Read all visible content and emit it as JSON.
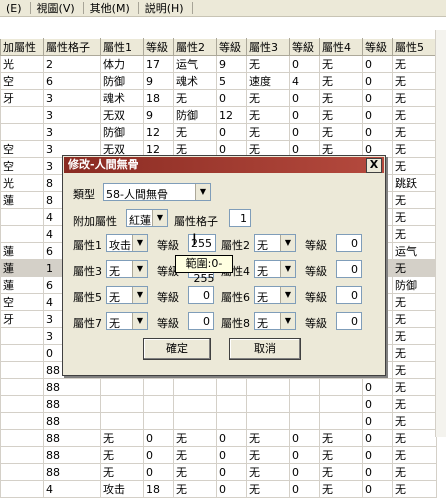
{
  "menu": [
    "(E)",
    "視圖(V)",
    "其他(M)",
    "説明(H)"
  ],
  "grid": {
    "headers": [
      "加屬性",
      "屬性格子",
      "屬性1",
      "等級",
      "屬性2",
      "等級",
      "屬性3",
      "等級",
      "屬性4",
      "等級",
      "屬性5"
    ],
    "rows": [
      [
        "光",
        "2",
        "体力",
        "17",
        "运气",
        "9",
        "无",
        "0",
        "无",
        "0",
        "无"
      ],
      [
        "空",
        "6",
        "防御",
        "9",
        "魂术",
        "5",
        "速度",
        "4",
        "无",
        "0",
        "无"
      ],
      [
        "牙",
        "3",
        "魂术",
        "18",
        "无",
        "0",
        "无",
        "0",
        "无",
        "0",
        "无"
      ],
      [
        "",
        "3",
        "无双",
        "9",
        "防御",
        "12",
        "无",
        "0",
        "无",
        "0",
        "无"
      ],
      [
        "",
        "3",
        "防御",
        "12",
        "无",
        "0",
        "无",
        "0",
        "无",
        "0",
        "无"
      ],
      [
        "空",
        "3",
        "无双",
        "12",
        "无",
        "0",
        "无",
        "0",
        "无",
        "0",
        "无"
      ],
      [
        "空",
        "3",
        "防御",
        "16",
        "无",
        "0",
        "无",
        "0",
        "无",
        "0",
        "无"
      ],
      [
        "光",
        "8",
        "速度",
        "20",
        "速度",
        "20",
        "速度",
        "20",
        "致胜",
        "20",
        "跳跃"
      ],
      [
        "蓮",
        "8",
        "",
        "",
        "",
        "",
        "",
        "",
        "",
        "0",
        "无"
      ],
      [
        "",
        "4",
        "",
        "",
        "",
        "",
        "",
        "",
        "",
        "0",
        "无"
      ],
      [
        "",
        "4",
        "",
        "",
        "",
        "",
        "",
        "",
        "",
        "0",
        "无"
      ],
      [
        "蓮",
        "6",
        "",
        "",
        "",
        "",
        "",
        "",
        "",
        "4",
        "运气"
      ],
      [
        "蓮",
        "1",
        "",
        "",
        "",
        "",
        "",
        "",
        "",
        "0",
        "无"
      ],
      [
        "蓮",
        "6",
        "",
        "",
        "",
        "",
        "",
        "",
        "",
        "0",
        "防御"
      ],
      [
        "空",
        "4",
        "",
        "",
        "",
        "",
        "",
        "",
        "",
        "0",
        "无"
      ],
      [
        "牙",
        "3",
        "",
        "",
        "",
        "",
        "",
        "",
        "",
        "0",
        "无"
      ],
      [
        "",
        "3",
        "",
        "",
        "",
        "",
        "",
        "",
        "",
        "0",
        "无"
      ],
      [
        "",
        "0",
        "",
        "",
        "",
        "",
        "",
        "",
        "",
        "0",
        "无"
      ],
      [
        "",
        "88",
        "",
        "",
        "",
        "",
        "",
        "",
        "",
        "0",
        "无"
      ],
      [
        "",
        "88",
        "",
        "",
        "",
        "",
        "",
        "",
        "",
        "0",
        "无"
      ],
      [
        "",
        "88",
        "",
        "",
        "",
        "",
        "",
        "",
        "",
        "0",
        "无"
      ],
      [
        "",
        "88",
        "",
        "",
        "",
        "",
        "",
        "",
        "",
        "0",
        "无"
      ],
      [
        "",
        "88",
        "无",
        "0",
        "无",
        "0",
        "无",
        "0",
        "无",
        "0",
        "无"
      ],
      [
        "",
        "88",
        "无",
        "0",
        "无",
        "0",
        "无",
        "0",
        "无",
        "0",
        "无"
      ],
      [
        "",
        "88",
        "无",
        "0",
        "无",
        "0",
        "无",
        "0",
        "无",
        "0",
        "无"
      ],
      [
        "",
        "4",
        "攻击",
        "18",
        "无",
        "0",
        "无",
        "0",
        "无",
        "0",
        "无"
      ]
    ]
  },
  "dialog": {
    "title": "修改-人間無骨",
    "close": "X",
    "type_label": "類型",
    "type_value": "58-人間無骨",
    "extra_label": "附加屬性",
    "extra_value": "紅蓮",
    "slots_label": "屬性格子",
    "slots_value": "1",
    "level_label": "等級",
    "attrs": [
      {
        "label": "屬性1",
        "value": "攻击",
        "level": "255"
      },
      {
        "label": "屬性2",
        "value": "无",
        "level": "0"
      },
      {
        "label": "屬性3",
        "value": "无",
        "level": "0"
      },
      {
        "label": "屬性4",
        "value": "无",
        "level": "0"
      },
      {
        "label": "屬性5",
        "value": "无",
        "level": "0"
      },
      {
        "label": "屬性6",
        "value": "无",
        "level": "0"
      },
      {
        "label": "屬性7",
        "value": "无",
        "level": "0"
      },
      {
        "label": "屬性8",
        "value": "无",
        "level": "0"
      }
    ],
    "ok": "確定",
    "cancel": "取消",
    "tooltip": "範圍:0-255"
  }
}
